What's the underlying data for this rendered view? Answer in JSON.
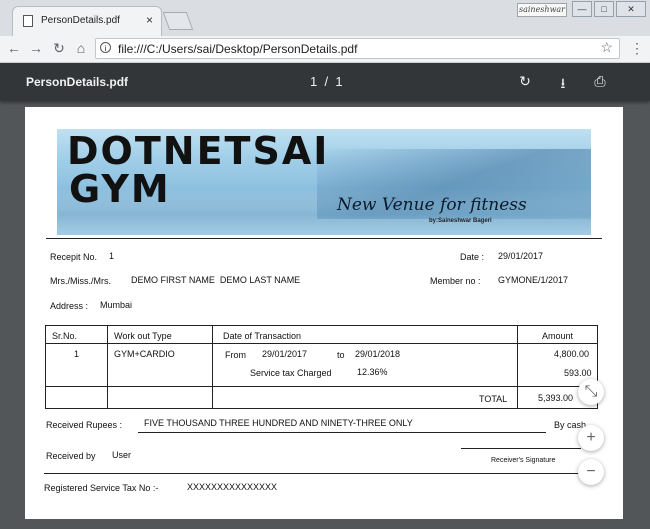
{
  "browser": {
    "tab_title": "PersonDetails.pdf",
    "tab_close": "×",
    "user_badge": "saineshwar",
    "win_min": "—",
    "win_max": "□",
    "win_close": "✕",
    "nav_back": "←",
    "nav_forward": "→",
    "nav_reload": "↻",
    "nav_home": "⌂",
    "info_icon": "i",
    "url": "file:///C:/Users/sai/Desktop/PersonDetails.pdf",
    "bookmark_star": "☆",
    "menu_dots": "⋮"
  },
  "pdf_viewer": {
    "title": "PersonDetails.pdf",
    "current_page": "1",
    "page_separator": "/",
    "total_pages": "1",
    "rotate_icon": "↻",
    "download_icon": "⭳",
    "print_icon": "⎙",
    "zoom_fit_icon": "⤡",
    "zoom_in_icon": "+",
    "zoom_out_icon": "−"
  },
  "receipt": {
    "banner": {
      "line1": "DOTNETSAI",
      "line2": "GYM",
      "tagline": "New Venue for fitness",
      "byline": "by:Saineshwar Bageri"
    },
    "receipt_no_label": "Recepit No.",
    "receipt_no": "1",
    "date_label": "Date :",
    "date": "29/01/2017",
    "name_label": "Mrs./Miss./Mrs.",
    "name": "DEMO FIRST NAME  DEMO LAST NAME",
    "member_label": "Member no :",
    "member_no": "GYMONE/1/2017",
    "address_label": "Address :",
    "address": "Mumbai",
    "table": {
      "headers": [
        "Sr.No.",
        "Work out Type",
        "Date of Transaction",
        "Amount"
      ],
      "sr_no": "1",
      "workout": "GYM+CARDIO",
      "from_label": "From",
      "from_date": "29/01/2017",
      "to_label": "to",
      "to_date": "29/01/2018",
      "tax_label": "Service tax Charged",
      "tax_rate": "12.36%",
      "amount": "4,800.00",
      "tax_amount": "593.00",
      "total_label": "TOTAL",
      "total": "5,393.00"
    },
    "received_rupees_label": "Received Rupees :",
    "amount_words": "FIVE THOUSAND THREE HUNDRED AND NINETY-THREE ONLY",
    "by_cash": "By cash",
    "received_by_label": "Received by",
    "received_by": "User",
    "signature_label": "Receiver's Signature",
    "service_tax_label": "Registered Service Tax  No :-",
    "service_tax_no": "XXXXXXXXXXXXXXX"
  }
}
